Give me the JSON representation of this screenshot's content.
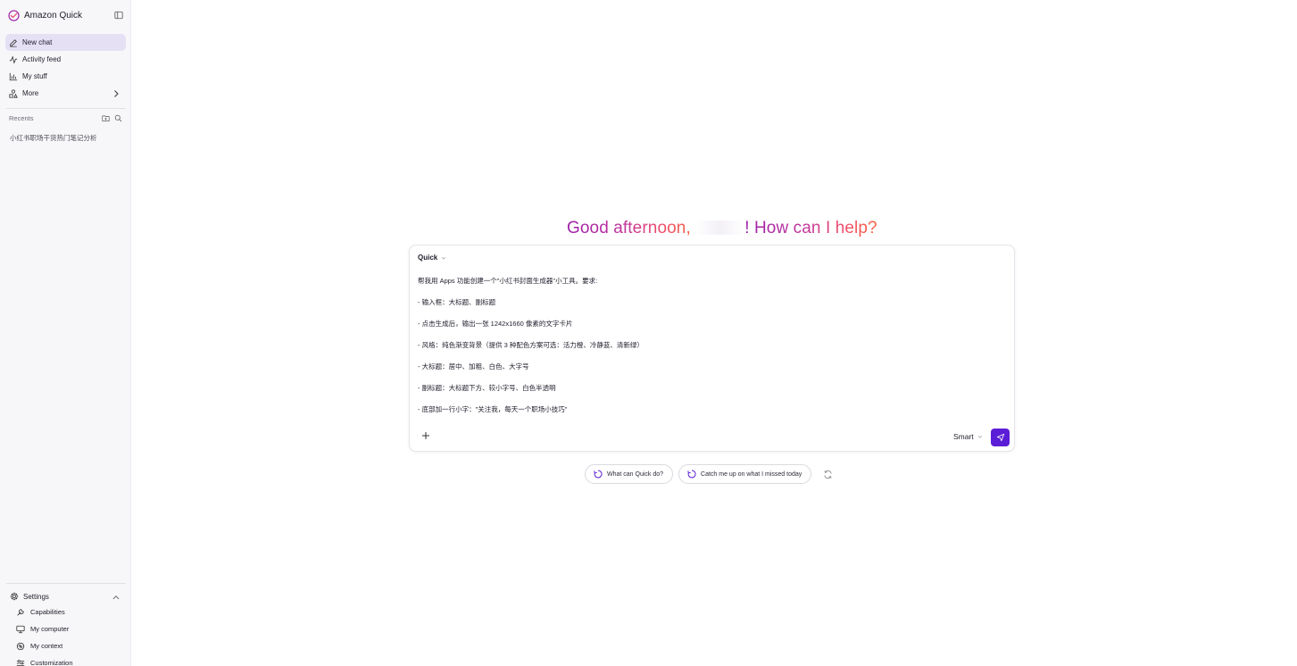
{
  "app": {
    "title": "Amazon Quick"
  },
  "sidebar": {
    "nav": [
      {
        "label": "New chat",
        "icon": "edit-icon",
        "active": true
      },
      {
        "label": "Activity feed",
        "icon": "activity-icon"
      },
      {
        "label": "My stuff",
        "icon": "chart-icon"
      },
      {
        "label": "More",
        "icon": "shapes-icon",
        "chevron": true
      }
    ],
    "recents_label": "Recents",
    "recents": [
      "小红书职场干货热门笔记分析"
    ],
    "settings_label": "Settings",
    "settings_items": [
      {
        "label": "Capabilities",
        "icon": "wrench-icon"
      },
      {
        "label": "My computer",
        "icon": "monitor-icon"
      },
      {
        "label": "My context",
        "icon": "context-icon"
      },
      {
        "label": "Customization",
        "icon": "sliders-icon"
      }
    ]
  },
  "main": {
    "greeting_pre": "Good afternoon, ",
    "greeting_post": "! How can I help?",
    "composer": {
      "agent": "Quick",
      "mode": "Smart",
      "prompt_lines": [
        "帮我用 Apps 功能创建一个\"小红书封面生成器\"小工具。要求:",
        "-  输入框：大标题、副标题",
        "-  点击生成后，输出一张 1242x1660 像素的文字卡片",
        "-  风格：纯色渐变背景（提供 3 种配色方案可选：活力橙、冷静蓝、清新绿）",
        "-  大标题：居中、加粗、白色、大字号",
        "-  副标题：大标题下方、较小字号、白色半透明",
        "-  底部加一行小字：\"关注我，每天一个职场小技巧\""
      ]
    },
    "suggestions": [
      "What can Quick do?",
      "Catch me up on what I missed today"
    ]
  },
  "colors": {
    "accent": "#5b1ed6",
    "active_nav": "#e6e0f5"
  }
}
